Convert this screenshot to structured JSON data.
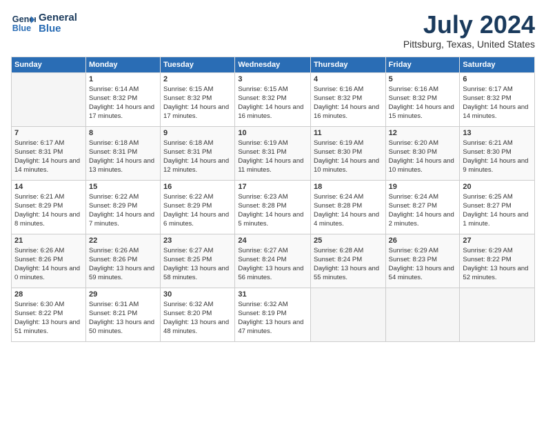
{
  "header": {
    "logo_line1": "General",
    "logo_line2": "Blue",
    "month": "July 2024",
    "location": "Pittsburg, Texas, United States"
  },
  "days_of_week": [
    "Sunday",
    "Monday",
    "Tuesday",
    "Wednesday",
    "Thursday",
    "Friday",
    "Saturday"
  ],
  "weeks": [
    [
      {
        "day": "",
        "sunrise": "",
        "sunset": "",
        "daylight": ""
      },
      {
        "day": "1",
        "sunrise": "Sunrise: 6:14 AM",
        "sunset": "Sunset: 8:32 PM",
        "daylight": "Daylight: 14 hours and 17 minutes."
      },
      {
        "day": "2",
        "sunrise": "Sunrise: 6:15 AM",
        "sunset": "Sunset: 8:32 PM",
        "daylight": "Daylight: 14 hours and 17 minutes."
      },
      {
        "day": "3",
        "sunrise": "Sunrise: 6:15 AM",
        "sunset": "Sunset: 8:32 PM",
        "daylight": "Daylight: 14 hours and 16 minutes."
      },
      {
        "day": "4",
        "sunrise": "Sunrise: 6:16 AM",
        "sunset": "Sunset: 8:32 PM",
        "daylight": "Daylight: 14 hours and 16 minutes."
      },
      {
        "day": "5",
        "sunrise": "Sunrise: 6:16 AM",
        "sunset": "Sunset: 8:32 PM",
        "daylight": "Daylight: 14 hours and 15 minutes."
      },
      {
        "day": "6",
        "sunrise": "Sunrise: 6:17 AM",
        "sunset": "Sunset: 8:32 PM",
        "daylight": "Daylight: 14 hours and 14 minutes."
      }
    ],
    [
      {
        "day": "7",
        "sunrise": "Sunrise: 6:17 AM",
        "sunset": "Sunset: 8:31 PM",
        "daylight": "Daylight: 14 hours and 14 minutes."
      },
      {
        "day": "8",
        "sunrise": "Sunrise: 6:18 AM",
        "sunset": "Sunset: 8:31 PM",
        "daylight": "Daylight: 14 hours and 13 minutes."
      },
      {
        "day": "9",
        "sunrise": "Sunrise: 6:18 AM",
        "sunset": "Sunset: 8:31 PM",
        "daylight": "Daylight: 14 hours and 12 minutes."
      },
      {
        "day": "10",
        "sunrise": "Sunrise: 6:19 AM",
        "sunset": "Sunset: 8:31 PM",
        "daylight": "Daylight: 14 hours and 11 minutes."
      },
      {
        "day": "11",
        "sunrise": "Sunrise: 6:19 AM",
        "sunset": "Sunset: 8:30 PM",
        "daylight": "Daylight: 14 hours and 10 minutes."
      },
      {
        "day": "12",
        "sunrise": "Sunrise: 6:20 AM",
        "sunset": "Sunset: 8:30 PM",
        "daylight": "Daylight: 14 hours and 10 minutes."
      },
      {
        "day": "13",
        "sunrise": "Sunrise: 6:21 AM",
        "sunset": "Sunset: 8:30 PM",
        "daylight": "Daylight: 14 hours and 9 minutes."
      }
    ],
    [
      {
        "day": "14",
        "sunrise": "Sunrise: 6:21 AM",
        "sunset": "Sunset: 8:29 PM",
        "daylight": "Daylight: 14 hours and 8 minutes."
      },
      {
        "day": "15",
        "sunrise": "Sunrise: 6:22 AM",
        "sunset": "Sunset: 8:29 PM",
        "daylight": "Daylight: 14 hours and 7 minutes."
      },
      {
        "day": "16",
        "sunrise": "Sunrise: 6:22 AM",
        "sunset": "Sunset: 8:29 PM",
        "daylight": "Daylight: 14 hours and 6 minutes."
      },
      {
        "day": "17",
        "sunrise": "Sunrise: 6:23 AM",
        "sunset": "Sunset: 8:28 PM",
        "daylight": "Daylight: 14 hours and 5 minutes."
      },
      {
        "day": "18",
        "sunrise": "Sunrise: 6:24 AM",
        "sunset": "Sunset: 8:28 PM",
        "daylight": "Daylight: 14 hours and 4 minutes."
      },
      {
        "day": "19",
        "sunrise": "Sunrise: 6:24 AM",
        "sunset": "Sunset: 8:27 PM",
        "daylight": "Daylight: 14 hours and 2 minutes."
      },
      {
        "day": "20",
        "sunrise": "Sunrise: 6:25 AM",
        "sunset": "Sunset: 8:27 PM",
        "daylight": "Daylight: 14 hours and 1 minute."
      }
    ],
    [
      {
        "day": "21",
        "sunrise": "Sunrise: 6:26 AM",
        "sunset": "Sunset: 8:26 PM",
        "daylight": "Daylight: 14 hours and 0 minutes."
      },
      {
        "day": "22",
        "sunrise": "Sunrise: 6:26 AM",
        "sunset": "Sunset: 8:26 PM",
        "daylight": "Daylight: 13 hours and 59 minutes."
      },
      {
        "day": "23",
        "sunrise": "Sunrise: 6:27 AM",
        "sunset": "Sunset: 8:25 PM",
        "daylight": "Daylight: 13 hours and 58 minutes."
      },
      {
        "day": "24",
        "sunrise": "Sunrise: 6:27 AM",
        "sunset": "Sunset: 8:24 PM",
        "daylight": "Daylight: 13 hours and 56 minutes."
      },
      {
        "day": "25",
        "sunrise": "Sunrise: 6:28 AM",
        "sunset": "Sunset: 8:24 PM",
        "daylight": "Daylight: 13 hours and 55 minutes."
      },
      {
        "day": "26",
        "sunrise": "Sunrise: 6:29 AM",
        "sunset": "Sunset: 8:23 PM",
        "daylight": "Daylight: 13 hours and 54 minutes."
      },
      {
        "day": "27",
        "sunrise": "Sunrise: 6:29 AM",
        "sunset": "Sunset: 8:22 PM",
        "daylight": "Daylight: 13 hours and 52 minutes."
      }
    ],
    [
      {
        "day": "28",
        "sunrise": "Sunrise: 6:30 AM",
        "sunset": "Sunset: 8:22 PM",
        "daylight": "Daylight: 13 hours and 51 minutes."
      },
      {
        "day": "29",
        "sunrise": "Sunrise: 6:31 AM",
        "sunset": "Sunset: 8:21 PM",
        "daylight": "Daylight: 13 hours and 50 minutes."
      },
      {
        "day": "30",
        "sunrise": "Sunrise: 6:32 AM",
        "sunset": "Sunset: 8:20 PM",
        "daylight": "Daylight: 13 hours and 48 minutes."
      },
      {
        "day": "31",
        "sunrise": "Sunrise: 6:32 AM",
        "sunset": "Sunset: 8:19 PM",
        "daylight": "Daylight: 13 hours and 47 minutes."
      },
      {
        "day": "",
        "sunrise": "",
        "sunset": "",
        "daylight": ""
      },
      {
        "day": "",
        "sunrise": "",
        "sunset": "",
        "daylight": ""
      },
      {
        "day": "",
        "sunrise": "",
        "sunset": "",
        "daylight": ""
      }
    ]
  ]
}
